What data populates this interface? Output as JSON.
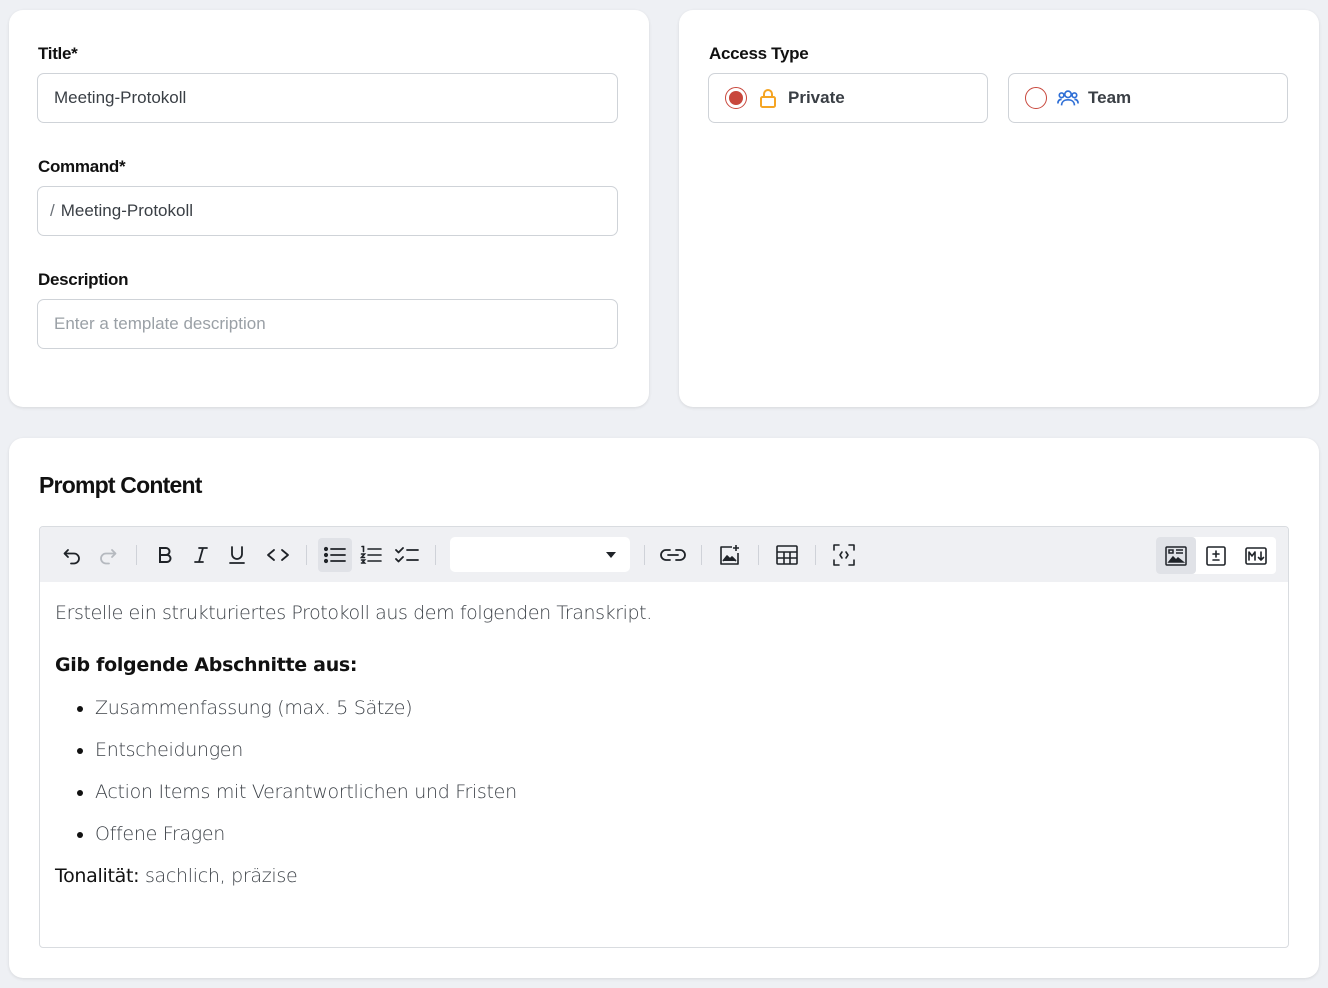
{
  "form": {
    "title_label": "Title*",
    "title_value": "Meeting-Protokoll",
    "command_label": "Command*",
    "command_prefix": "/",
    "command_value": "Meeting-Protokoll",
    "description_label": "Description",
    "description_placeholder": "Enter a template description",
    "description_value": ""
  },
  "access": {
    "label": "Access Type",
    "options": [
      {
        "label": "Private",
        "icon": "lock-icon",
        "selected": true,
        "icon_color": "#f5a524"
      },
      {
        "label": "Team",
        "icon": "users-icon",
        "selected": false,
        "icon_color": "#2f6fd6"
      }
    ],
    "radio_color": "#c8473c"
  },
  "prompt": {
    "title": "Prompt Content",
    "toolbar": {
      "buttons": [
        "undo-icon",
        "redo-icon",
        "bold-icon",
        "italic-icon",
        "underline-icon",
        "code-icon",
        "bullet-list-icon",
        "ordered-list-icon",
        "checklist-icon",
        "heading-select",
        "link-icon",
        "image-add-icon",
        "table-icon",
        "fullscreen-icon",
        "rich-text-mode-icon",
        "diff-mode-icon",
        "markdown-mode-icon"
      ],
      "heading_select_value": "",
      "active": [
        "bullet-list-icon",
        "rich-text-mode-icon"
      ]
    },
    "content": {
      "intro": "Erstelle ein strukturiertes Protokoll aus dem folgenden Transkript.",
      "heading": "Gib folgende Abschnitte aus:",
      "items": [
        "Zusammenfassung (max. 5 Sätze)",
        "Entscheidungen",
        "Action Items mit Verantwortlichen und Fristen",
        "Offene Fragen"
      ],
      "tone_label": "Tonalität:",
      "tone_value": " sachlich, präzise"
    }
  }
}
